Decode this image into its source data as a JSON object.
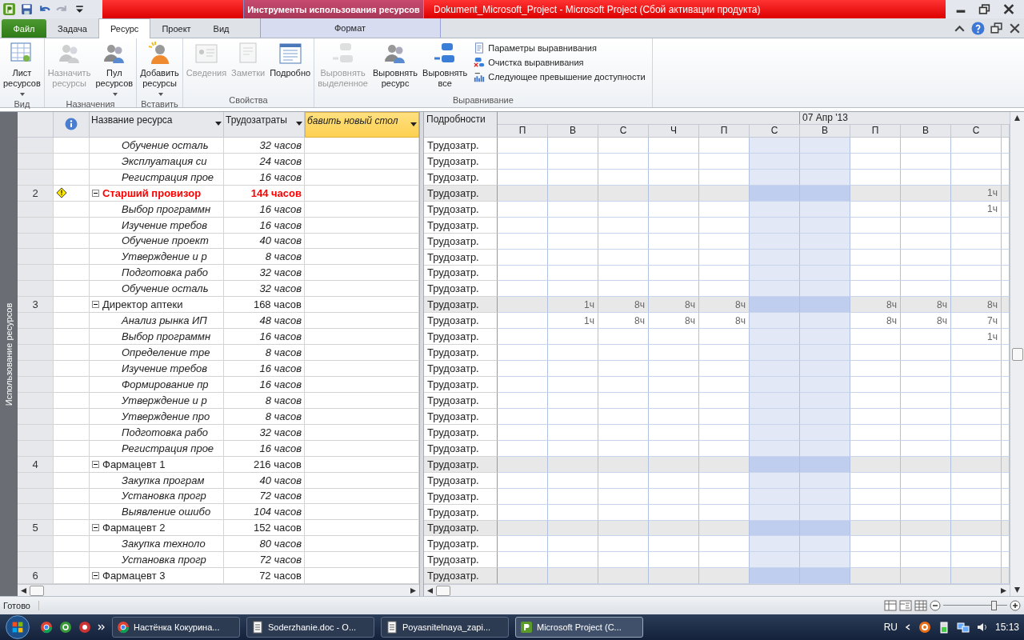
{
  "title_bar": {
    "context_group": "Инструменты использования ресурсов",
    "title": "Dokument_Microsoft_Project  -  Microsoft Project (Сбой активации продукта)"
  },
  "ribbon_tabs": [
    {
      "label": "Файл",
      "kind": "file",
      "selected": false
    },
    {
      "label": "Задача",
      "kind": "tab",
      "selected": false
    },
    {
      "label": "Ресурс",
      "kind": "tab",
      "selected": true
    },
    {
      "label": "Проект",
      "kind": "tab",
      "selected": false
    },
    {
      "label": "Вид",
      "kind": "tab",
      "selected": false
    },
    {
      "label": "Формат",
      "kind": "context",
      "selected": false
    }
  ],
  "ribbon_groups": [
    {
      "label": "Вид",
      "buttons": [
        {
          "label": "Лист ресурсов",
          "kind": "large",
          "dropdown": true,
          "disabled": false
        }
      ]
    },
    {
      "label": "Назначения",
      "buttons": [
        {
          "label": "Назначить ресурсы",
          "kind": "large",
          "dropdown": false,
          "disabled": true
        },
        {
          "label": "Пул ресурсов",
          "kind": "large",
          "dropdown": true,
          "disabled": false
        }
      ]
    },
    {
      "label": "Вставить",
      "buttons": [
        {
          "label": "Добавить ресурсы",
          "kind": "large",
          "dropdown": true,
          "disabled": false
        }
      ]
    },
    {
      "label": "Свойства",
      "buttons": [
        {
          "label": "Сведения",
          "kind": "large",
          "dropdown": false,
          "disabled": true
        },
        {
          "label": "Заметки",
          "kind": "large",
          "dropdown": false,
          "disabled": true
        },
        {
          "label": "Подробно",
          "kind": "large",
          "dropdown": false,
          "disabled": false
        }
      ]
    },
    {
      "label": "Выравнивание",
      "buttons": [
        {
          "label": "Выровнять выделенное",
          "kind": "large",
          "dropdown": false,
          "disabled": true
        },
        {
          "label": "Выровнять ресурс",
          "kind": "large",
          "dropdown": false,
          "disabled": false
        },
        {
          "label": "Выровнять все",
          "kind": "large",
          "dropdown": false,
          "disabled": false
        },
        {
          "label": "Параметры выравнивания",
          "kind": "small",
          "disabled": false
        },
        {
          "label": "Очистка выравнивания",
          "kind": "small",
          "disabled": false
        },
        {
          "label": "Следующее превышение доступности",
          "kind": "small",
          "disabled": false
        }
      ]
    }
  ],
  "side_label": "Использование ресурсов",
  "table": {
    "columns": [
      "Название ресурса",
      "Трудозатраты",
      "бавить новый стол"
    ]
  },
  "timescale": {
    "details_header": "Подробности",
    "week_label": "07 Апр '13",
    "days": [
      "П",
      "В",
      "С",
      "Ч",
      "П",
      "С",
      "В",
      "П",
      "В",
      "С"
    ]
  },
  "rows": [
    {
      "kind": "assignment",
      "name": "Обучение осталь",
      "work": "32 часов",
      "detail": "Трудозатр.",
      "cells": [
        {
          "weekend": false
        },
        {
          "weekend": false
        },
        {
          "weekend": false
        },
        {
          "weekend": false
        },
        {
          "weekend": false
        },
        {
          "weekend": true
        },
        {
          "weekend": true
        },
        {
          "weekend": false
        },
        {
          "weekend": false
        },
        {
          "weekend": false
        }
      ]
    },
    {
      "kind": "assignment",
      "name": "Эксплуатация си",
      "work": "24 часов",
      "detail": "Трудозатр.",
      "cells": [
        {
          "weekend": false
        },
        {
          "weekend": false
        },
        {
          "weekend": false
        },
        {
          "weekend": false
        },
        {
          "weekend": false
        },
        {
          "weekend": true
        },
        {
          "weekend": true
        },
        {
          "weekend": false
        },
        {
          "weekend": false
        },
        {
          "weekend": false
        }
      ]
    },
    {
      "kind": "assignment",
      "name": "Регистрация прое",
      "work": "16 часов",
      "detail": "Трудозатр.",
      "cells": [
        {
          "weekend": false
        },
        {
          "weekend": false
        },
        {
          "weekend": false
        },
        {
          "weekend": false
        },
        {
          "weekend": false
        },
        {
          "weekend": true
        },
        {
          "weekend": true
        },
        {
          "weekend": false
        },
        {
          "weekend": false
        },
        {
          "weekend": false
        }
      ]
    },
    {
      "kind": "summary",
      "id": "2",
      "warning": true,
      "overallocated": true,
      "expanded": true,
      "name": "Старший провизор",
      "work": "144 часов",
      "detail": "Трудозатр.",
      "cells": [
        {
          "weekend": false
        },
        {
          "weekend": false
        },
        {
          "weekend": false
        },
        {
          "weekend": false
        },
        {
          "weekend": false
        },
        {
          "weekend": true
        },
        {
          "weekend": true
        },
        {
          "weekend": false
        },
        {
          "weekend": false
        },
        {
          "weekend": false,
          "text": "1ч"
        }
      ]
    },
    {
      "kind": "assignment",
      "name": "Выбор программн",
      "work": "16 часов",
      "detail": "Трудозатр.",
      "cells": [
        {
          "weekend": false
        },
        {
          "weekend": false
        },
        {
          "weekend": false
        },
        {
          "weekend": false
        },
        {
          "weekend": false
        },
        {
          "weekend": true
        },
        {
          "weekend": true
        },
        {
          "weekend": false
        },
        {
          "weekend": false
        },
        {
          "weekend": false,
          "text": "1ч"
        }
      ]
    },
    {
      "kind": "assignment",
      "name": "Изучение требов",
      "work": "16 часов",
      "detail": "Трудозатр.",
      "cells": [
        {
          "weekend": false
        },
        {
          "weekend": false
        },
        {
          "weekend": false
        },
        {
          "weekend": false
        },
        {
          "weekend": false
        },
        {
          "weekend": true
        },
        {
          "weekend": true
        },
        {
          "weekend": false
        },
        {
          "weekend": false
        },
        {
          "weekend": false
        }
      ]
    },
    {
      "kind": "assignment",
      "name": "Обучение проект",
      "work": "40 часов",
      "detail": "Трудозатр.",
      "cells": [
        {
          "weekend": false
        },
        {
          "weekend": false
        },
        {
          "weekend": false
        },
        {
          "weekend": false
        },
        {
          "weekend": false
        },
        {
          "weekend": true
        },
        {
          "weekend": true
        },
        {
          "weekend": false
        },
        {
          "weekend": false
        },
        {
          "weekend": false
        }
      ]
    },
    {
      "kind": "assignment",
      "name": "Утверждение и р",
      "work": "8 часов",
      "detail": "Трудозатр.",
      "cells": [
        {
          "weekend": false
        },
        {
          "weekend": false
        },
        {
          "weekend": false
        },
        {
          "weekend": false
        },
        {
          "weekend": false
        },
        {
          "weekend": true
        },
        {
          "weekend": true
        },
        {
          "weekend": false
        },
        {
          "weekend": false
        },
        {
          "weekend": false
        }
      ]
    },
    {
      "kind": "assignment",
      "name": "Подготовка рабо",
      "work": "32 часов",
      "detail": "Трудозатр.",
      "cells": [
        {
          "weekend": false
        },
        {
          "weekend": false
        },
        {
          "weekend": false
        },
        {
          "weekend": false
        },
        {
          "weekend": false
        },
        {
          "weekend": true
        },
        {
          "weekend": true
        },
        {
          "weekend": false
        },
        {
          "weekend": false
        },
        {
          "weekend": false
        }
      ]
    },
    {
      "kind": "assignment",
      "name": "Обучение осталь",
      "work": "32 часов",
      "detail": "Трудозатр.",
      "cells": [
        {
          "weekend": false
        },
        {
          "weekend": false
        },
        {
          "weekend": false
        },
        {
          "weekend": false
        },
        {
          "weekend": false
        },
        {
          "weekend": true
        },
        {
          "weekend": true
        },
        {
          "weekend": false
        },
        {
          "weekend": false
        },
        {
          "weekend": false
        }
      ]
    },
    {
      "kind": "summary",
      "id": "3",
      "warning": false,
      "overallocated": false,
      "expanded": true,
      "name": "Директор аптеки",
      "work": "168 часов",
      "detail": "Трудозатр.",
      "cells": [
        {
          "weekend": false
        },
        {
          "weekend": false,
          "text": "1ч"
        },
        {
          "weekend": false,
          "text": "8ч"
        },
        {
          "weekend": false,
          "text": "8ч"
        },
        {
          "weekend": false,
          "text": "8ч"
        },
        {
          "weekend": true
        },
        {
          "weekend": true
        },
        {
          "weekend": false,
          "text": "8ч"
        },
        {
          "weekend": false,
          "text": "8ч"
        },
        {
          "weekend": false,
          "text": "8ч"
        }
      ]
    },
    {
      "kind": "assignment",
      "name": "Анализ рынка ИП",
      "work": "48 часов",
      "detail": "Трудозатр.",
      "cells": [
        {
          "weekend": false
        },
        {
          "weekend": false,
          "text": "1ч"
        },
        {
          "weekend": false,
          "text": "8ч"
        },
        {
          "weekend": false,
          "text": "8ч"
        },
        {
          "weekend": false,
          "text": "8ч"
        },
        {
          "weekend": true
        },
        {
          "weekend": true
        },
        {
          "weekend": false,
          "text": "8ч"
        },
        {
          "weekend": false,
          "text": "8ч"
        },
        {
          "weekend": false,
          "text": "7ч"
        }
      ]
    },
    {
      "kind": "assignment",
      "name": "Выбор программн",
      "work": "16 часов",
      "detail": "Трудозатр.",
      "cells": [
        {
          "weekend": false
        },
        {
          "weekend": false
        },
        {
          "weekend": false
        },
        {
          "weekend": false
        },
        {
          "weekend": false
        },
        {
          "weekend": true
        },
        {
          "weekend": true
        },
        {
          "weekend": false
        },
        {
          "weekend": false
        },
        {
          "weekend": false,
          "text": "1ч"
        }
      ]
    },
    {
      "kind": "assignment",
      "name": "Определение тре",
      "work": "8 часов",
      "detail": "Трудозатр.",
      "cells": [
        {
          "weekend": false
        },
        {
          "weekend": false
        },
        {
          "weekend": false
        },
        {
          "weekend": false
        },
        {
          "weekend": false
        },
        {
          "weekend": true
        },
        {
          "weekend": true
        },
        {
          "weekend": false
        },
        {
          "weekend": false
        },
        {
          "weekend": false
        }
      ]
    },
    {
      "kind": "assignment",
      "name": "Изучение требов",
      "work": "16 часов",
      "detail": "Трудозатр.",
      "cells": [
        {
          "weekend": false
        },
        {
          "weekend": false
        },
        {
          "weekend": false
        },
        {
          "weekend": false
        },
        {
          "weekend": false
        },
        {
          "weekend": true
        },
        {
          "weekend": true
        },
        {
          "weekend": false
        },
        {
          "weekend": false
        },
        {
          "weekend": false
        }
      ]
    },
    {
      "kind": "assignment",
      "name": "Формирование пр",
      "work": "16 часов",
      "detail": "Трудозатр.",
      "cells": [
        {
          "weekend": false
        },
        {
          "weekend": false
        },
        {
          "weekend": false
        },
        {
          "weekend": false
        },
        {
          "weekend": false
        },
        {
          "weekend": true
        },
        {
          "weekend": true
        },
        {
          "weekend": false
        },
        {
          "weekend": false
        },
        {
          "weekend": false
        }
      ]
    },
    {
      "kind": "assignment",
      "name": "Утверждение и р",
      "work": "8 часов",
      "detail": "Трудозатр.",
      "cells": [
        {
          "weekend": false
        },
        {
          "weekend": false
        },
        {
          "weekend": false
        },
        {
          "weekend": false
        },
        {
          "weekend": false
        },
        {
          "weekend": true
        },
        {
          "weekend": true
        },
        {
          "weekend": false
        },
        {
          "weekend": false
        },
        {
          "weekend": false
        }
      ]
    },
    {
      "kind": "assignment",
      "name": "Утверждение про",
      "work": "8 часов",
      "detail": "Трудозатр.",
      "cells": [
        {
          "weekend": false
        },
        {
          "weekend": false
        },
        {
          "weekend": false
        },
        {
          "weekend": false
        },
        {
          "weekend": false
        },
        {
          "weekend": true
        },
        {
          "weekend": true
        },
        {
          "weekend": false
        },
        {
          "weekend": false
        },
        {
          "weekend": false
        }
      ]
    },
    {
      "kind": "assignment",
      "name": "Подготовка рабо",
      "work": "32 часов",
      "detail": "Трудозатр.",
      "cells": [
        {
          "weekend": false
        },
        {
          "weekend": false
        },
        {
          "weekend": false
        },
        {
          "weekend": false
        },
        {
          "weekend": false
        },
        {
          "weekend": true
        },
        {
          "weekend": true
        },
        {
          "weekend": false
        },
        {
          "weekend": false
        },
        {
          "weekend": false
        }
      ]
    },
    {
      "kind": "assignment",
      "name": "Регистрация прое",
      "work": "16 часов",
      "detail": "Трудозатр.",
      "cells": [
        {
          "weekend": false
        },
        {
          "weekend": false
        },
        {
          "weekend": false
        },
        {
          "weekend": false
        },
        {
          "weekend": false
        },
        {
          "weekend": true
        },
        {
          "weekend": true
        },
        {
          "weekend": false
        },
        {
          "weekend": false
        },
        {
          "weekend": false
        }
      ]
    },
    {
      "kind": "summary",
      "id": "4",
      "warning": false,
      "overallocated": false,
      "expanded": true,
      "name": "Фармацевт 1",
      "work": "216 часов",
      "detail": "Трудозатр.",
      "cells": [
        {
          "weekend": false
        },
        {
          "weekend": false
        },
        {
          "weekend": false
        },
        {
          "weekend": false
        },
        {
          "weekend": false
        },
        {
          "weekend": true
        },
        {
          "weekend": true
        },
        {
          "weekend": false
        },
        {
          "weekend": false
        },
        {
          "weekend": false
        }
      ]
    },
    {
      "kind": "assignment",
      "name": "Закупка програм",
      "work": "40 часов",
      "detail": "Трудозатр.",
      "cells": [
        {
          "weekend": false
        },
        {
          "weekend": false
        },
        {
          "weekend": false
        },
        {
          "weekend": false
        },
        {
          "weekend": false
        },
        {
          "weekend": true
        },
        {
          "weekend": true
        },
        {
          "weekend": false
        },
        {
          "weekend": false
        },
        {
          "weekend": false
        }
      ]
    },
    {
      "kind": "assignment",
      "name": "Установка прогр",
      "work": "72 часов",
      "detail": "Трудозатр.",
      "cells": [
        {
          "weekend": false
        },
        {
          "weekend": false
        },
        {
          "weekend": false
        },
        {
          "weekend": false
        },
        {
          "weekend": false
        },
        {
          "weekend": true
        },
        {
          "weekend": true
        },
        {
          "weekend": false
        },
        {
          "weekend": false
        },
        {
          "weekend": false
        }
      ]
    },
    {
      "kind": "assignment",
      "name": "Выявление ошибо",
      "work": "104 часов",
      "detail": "Трудозатр.",
      "cells": [
        {
          "weekend": false
        },
        {
          "weekend": false
        },
        {
          "weekend": false
        },
        {
          "weekend": false
        },
        {
          "weekend": false
        },
        {
          "weekend": true
        },
        {
          "weekend": true
        },
        {
          "weekend": false
        },
        {
          "weekend": false
        },
        {
          "weekend": false
        }
      ]
    },
    {
      "kind": "summary",
      "id": "5",
      "warning": false,
      "overallocated": false,
      "expanded": true,
      "name": "Фармацевт 2",
      "work": "152 часов",
      "detail": "Трудозатр.",
      "cells": [
        {
          "weekend": false
        },
        {
          "weekend": false
        },
        {
          "weekend": false
        },
        {
          "weekend": false
        },
        {
          "weekend": false
        },
        {
          "weekend": true
        },
        {
          "weekend": true
        },
        {
          "weekend": false
        },
        {
          "weekend": false
        },
        {
          "weekend": false
        }
      ]
    },
    {
      "kind": "assignment",
      "name": "Закупка техноло",
      "work": "80 часов",
      "detail": "Трудозатр.",
      "cells": [
        {
          "weekend": false
        },
        {
          "weekend": false
        },
        {
          "weekend": false
        },
        {
          "weekend": false
        },
        {
          "weekend": false
        },
        {
          "weekend": true
        },
        {
          "weekend": true
        },
        {
          "weekend": false
        },
        {
          "weekend": false
        },
        {
          "weekend": false
        }
      ]
    },
    {
      "kind": "assignment",
      "name": "Установка прогр",
      "work": "72 часов",
      "detail": "Трудозатр.",
      "cells": [
        {
          "weekend": false
        },
        {
          "weekend": false
        },
        {
          "weekend": false
        },
        {
          "weekend": false
        },
        {
          "weekend": false
        },
        {
          "weekend": true
        },
        {
          "weekend": true
        },
        {
          "weekend": false
        },
        {
          "weekend": false
        },
        {
          "weekend": false
        }
      ]
    },
    {
      "kind": "summary",
      "id": "6",
      "warning": false,
      "overallocated": false,
      "expanded": true,
      "name": "Фармацевт 3",
      "work": "72 часов",
      "detail": "Трудозатр.",
      "cells": [
        {
          "weekend": false
        },
        {
          "weekend": false
        },
        {
          "weekend": false
        },
        {
          "weekend": false
        },
        {
          "weekend": false
        },
        {
          "weekend": true
        },
        {
          "weekend": true
        },
        {
          "weekend": false
        },
        {
          "weekend": false
        },
        {
          "weekend": false
        }
      ]
    }
  ],
  "status_bar": {
    "text": "Готово",
    "zoom": {
      "level": 0.8
    }
  },
  "taskbar": {
    "items": [
      {
        "label": "Настёнка Кокурина...",
        "kind": "browser",
        "selected": false
      },
      {
        "label": "Soderzhanie.doc - O...",
        "kind": "doc",
        "selected": false
      },
      {
        "label": "Poyasnitelnaya_zapi...",
        "kind": "doc",
        "selected": false
      },
      {
        "label": "Microsoft Project (C...",
        "kind": "project",
        "selected": true
      }
    ],
    "language": "RU",
    "time": "15:13"
  }
}
